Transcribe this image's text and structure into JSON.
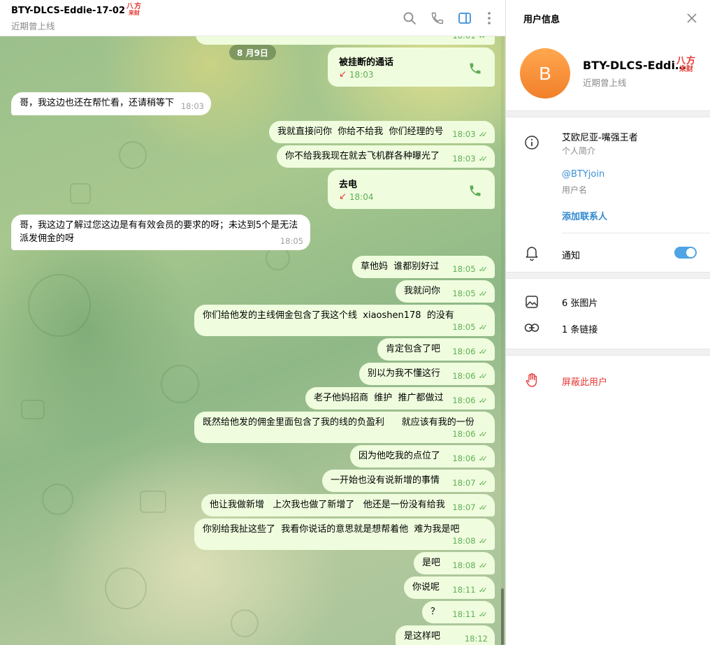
{
  "header": {
    "title": "BTY-DLCS-Eddie-17-02",
    "status": "近期曾上线",
    "logo_line1": "八方",
    "logo_line2": "来财"
  },
  "date_divider": "8 月9日",
  "top_partial": {
    "time": "18:01"
  },
  "messages": [
    {
      "id": "call1",
      "kind": "call",
      "title": "被挂断的通话",
      "time": "18:03"
    },
    {
      "id": "m1",
      "dir": "in",
      "text": "哥，我这边也还在帮忙看，还请稍等下",
      "time": "18:03"
    },
    {
      "id": "m2",
      "dir": "out",
      "text": "我就直接问你  你给不给我  你们经理的号",
      "time": "18:03"
    },
    {
      "id": "m3",
      "dir": "out",
      "text": "你不给我我现在就去飞机群各种曝光了",
      "time": "18:03"
    },
    {
      "id": "call2",
      "kind": "call",
      "title": "去电",
      "time": "18:04"
    },
    {
      "id": "m4",
      "dir": "in",
      "text": "哥，我这边了解过您这边是有有效会员的要求的呀；未达到5个是无法派发佣金的呀",
      "time": "18:05"
    },
    {
      "id": "m5",
      "dir": "out",
      "text": "草他妈  谁都别好过",
      "time": "18:05"
    },
    {
      "id": "m6",
      "dir": "out",
      "text": "我就问你",
      "time": "18:05"
    },
    {
      "id": "m7",
      "dir": "out",
      "text": "你们给他发的主线佣金包含了我这个线  xiaoshen178  的没有",
      "time": "18:05"
    },
    {
      "id": "m8",
      "dir": "out",
      "text": "肯定包含了吧",
      "time": "18:06"
    },
    {
      "id": "m9",
      "dir": "out",
      "text": "别以为我不懂这行",
      "time": "18:06"
    },
    {
      "id": "m10",
      "dir": "out",
      "text": "老子他妈招商  维护  推广都做过",
      "time": "18:06"
    },
    {
      "id": "m11",
      "dir": "out",
      "text": "既然给他发的佣金里面包含了我的线的负盈利      就应该有我的一份",
      "time": "18:06"
    },
    {
      "id": "m12",
      "dir": "out",
      "text": "因为他吃我的点位了",
      "time": "18:06"
    },
    {
      "id": "m13",
      "dir": "out",
      "text": "一开始也没有说新增的事情",
      "time": "18:07"
    },
    {
      "id": "m14",
      "dir": "out",
      "text": "他让我做新增   上次我也做了新增了   他还是一份没有给我",
      "time": "18:07"
    },
    {
      "id": "m15",
      "dir": "out",
      "text": "你别给我扯这些了  我看你说话的意思就是想帮着他  难为我是吧",
      "time": "18:08"
    },
    {
      "id": "m16",
      "dir": "out",
      "text": "是吧",
      "time": "18:08"
    },
    {
      "id": "m17",
      "dir": "out",
      "text": "你说呢",
      "time": "18:11"
    },
    {
      "id": "m18",
      "dir": "out",
      "text": "？",
      "time": "18:11"
    },
    {
      "id": "m19",
      "dir": "out",
      "text": "是这样吧",
      "time": "18:12"
    }
  ],
  "panel": {
    "title": "用户信息",
    "avatar_letter": "B",
    "name": "BTY-DLCS-Eddi…",
    "status": "近期曾上线",
    "bio": "艾欧尼亚-嘴强王者",
    "bio_label": "个人简介",
    "username": "@BTYjoin",
    "username_label": "用户名",
    "add_contact": "添加联系人",
    "notifications": "通知",
    "notifications_on": true,
    "photos": "6 张图片",
    "links": "1 条链接",
    "block": "屏蔽此用户"
  },
  "colors": {
    "accent": "#4ea4e4",
    "outgoing_bubble": "#effdde",
    "check_green": "#5fad56",
    "danger": "#e53935",
    "avatar": "#f27f2a"
  }
}
